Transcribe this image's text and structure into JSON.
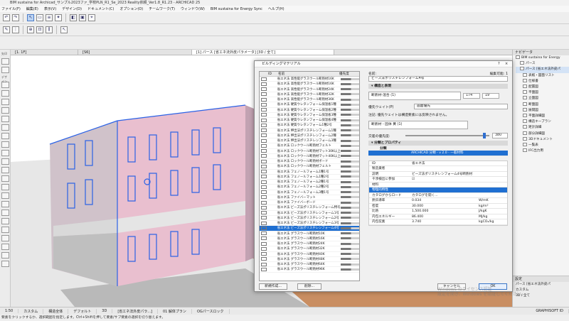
{
  "app": {
    "title": "BIM sustaina for Archicad_サンプル2023ファ_学校PLN_R1_Se_2023 Reality依頼_Ver1.8_R1.23 - ARCHICAD 25"
  },
  "menu": [
    "ファイル(F)",
    "編集(E)",
    "表示(V)",
    "デザイン(D)",
    "ドキュメント(C)",
    "オプション(O)",
    "チームワーク(T)",
    "ウィンドウ(W)",
    "BIM sustaina for Energy Sync",
    "ヘルプ(H)"
  ],
  "view_tabs": {
    "tab1": "[1. 1F]",
    "tab2": "[S6]",
    "tab3": "[1] パース [省エネ法外皮パラメータ] [3D / 全て]"
  },
  "left_labels": {
    "select": "矢印",
    "design": "デザイン"
  },
  "dialog": {
    "title": "ビルディングマテリアル",
    "help": "?",
    "close": "×",
    "list_header": {
      "id": "ID",
      "name": "名前",
      "priority": "優先度"
    },
    "materials": [
      "省エネ法 高性能グラスウール断熱材16K",
      "省エネ法 高性能グラスウール断熱材16K",
      "省エネ法 高性能グラスウール断熱材24K",
      "省エネ法 高性能グラスウール断熱材32K",
      "省エネ法 高性能グラスウール断熱材36K",
      "省エネ法 硬質ウレタンフォーム保温板1種",
      "省エネ法 硬質ウレタンフォーム保温板2種",
      "省エネ法 硬質ウレタンフォーム保温板3種",
      "省エネ法 硬質ウレタンフォーム保温板4種",
      "省エネ法 硬質ウレタンフォーム1種2号",
      "省エネ法 押出法ポリスチレンフォーム1種",
      "省エネ法 押出法ポリスチレンフォーム2種",
      "省エネ法 押出法ポリスチレンフォーム3種",
      "省エネ法 ロックウール断熱材フェルト",
      "省エネ法 ロックウール断熱材マット30K以上",
      "省エネ法 ロックウール断熱材マット40K以上",
      "省エネ法 ロックウール断熱材ボード",
      "省エネ法 ロックウール断熱材フェルト",
      "省エネ法 フェノールフォーム1種1号",
      "省エネ法 フェノールフォーム1種2号",
      "省エネ法 フェノールフォーム2種1号",
      "省エネ法 フェノールフォーム2種2号",
      "省エネ法 フェノールフォーム3種1号",
      "省エネ法 ファイバーマット",
      "省エネ法 ファイバーボード",
      "省エネ法 ビーズ法ポリスチレンフォーム特号",
      "省エネ法 ビーズ法ポリスチレンフォーム1号",
      "省エネ法 ビーズ法ポリスチレンフォーム2号",
      "省エネ法 ビーズ法ポリスチレンフォーム3号",
      "省エネ法 ビーズ法ポリスチレンフォーム4号",
      "省エネ法 グラスウール断熱材10K",
      "省エネ法 グラスウール断熱材16K",
      "省エネ法 グラスウール断熱材24K",
      "省エネ法 グラスウール断熱材32K",
      "省エネ法 グラスウール断熱材40K",
      "省エネ法 グラスウール断熱材48K",
      "省エネ法 グラスウール断熱材64K",
      "省エネ法 グラスウール断熱材96K"
    ],
    "selected_index": 29,
    "new_btn": "新規作成...",
    "delete_btn": "削除...",
    "cancel_btn": "キャンセル",
    "ok_btn": "OK",
    "name_label": "名前:",
    "edit_label": "編集可能: 1",
    "name_value": "ビーズ法ポリスチレンフォーム4号",
    "sec_visual": "▾ 構造と表現",
    "fill_value": "断熱材-混合 (1)",
    "pen1": "174",
    "pen2": "19",
    "surface_label": "優先ウェイト(P)",
    "surface_value": "画面優先",
    "note": "注記: 優先ウェイトは構造要素には反映されません。",
    "cut_label": "切断塗りつぶし",
    "cut_value": "断熱材 - 固体 黄 (1)",
    "priority_label": "交差の優先度:",
    "priority_value": "380",
    "sec_class": "▾ 分類とプロパティ",
    "class_head": "分類",
    "class_value": "ARCHICAD 分類 - v 2.0 - 一般材料",
    "props": [
      {
        "k": "ID",
        "v": "省エネ法",
        "u": ""
      },
      {
        "k": "製造業者",
        "v": "",
        "u": ""
      },
      {
        "k": "説明",
        "v": "ビーズ法ポリスチレンフォーム4号断熱材",
        "u": ""
      },
      {
        "k": "干渉検出に参加",
        "v": "☑",
        "u": ""
      },
      {
        "k": "材料",
        "v": "",
        "u": ""
      },
      {
        "k": "物理的特性",
        "v": "",
        "u": ""
      },
      {
        "k": "カタログからロード",
        "v": "カタログを開く...",
        "u": ""
      },
      {
        "k": "熱伝導率",
        "v": "0.034",
        "u": "W/mK"
      },
      {
        "k": "密度",
        "v": "30.000",
        "u": "kg/m³"
      },
      {
        "k": "比熱",
        "v": "1,500.000",
        "u": "J/kgK"
      },
      {
        "k": "内包エネルギー",
        "v": "86.400",
        "u": "MJ/kg"
      },
      {
        "k": "内包炭素",
        "v": "3.740",
        "u": "kgCO₂/kg"
      }
    ]
  },
  "right_panel": {
    "header": "ナビゲータ",
    "items": [
      "BIM sustaina for Energy",
      "パース",
      "パース [省エネ法外皮パ",
      "表紙・図面リスト",
      "仕様書",
      "配置図",
      "平面図",
      "立面図",
      "断面図",
      "展開図",
      "平面詳細図",
      "構造キープラン",
      "矩計詳細",
      "部分詳細図",
      "3Dドキュメント",
      "一覧表",
      "IFC出力用"
    ],
    "bottom_header": "設定",
    "bottom_items": [
      "パース [省エネ法外皮パ",
      "カスタム",
      "3D / 全て"
    ]
  },
  "watermark": [
    "Windows のライセンス認証",
    "設定を開き、Windows を認証してください。"
  ],
  "status": [
    "1:50",
    "カスタム",
    "構造全体",
    "デフォルト",
    "3D",
    "[省エネ法外皮パラ...]",
    "01 解体プラン",
    "OGパースロック"
  ],
  "status_brand": "GRAPHISOFT ID",
  "hint": "要素をクリックするか、選択範囲を指定します。Ctrl+Shiftを押して要素/サブ要素の選択を切り替えます。"
}
